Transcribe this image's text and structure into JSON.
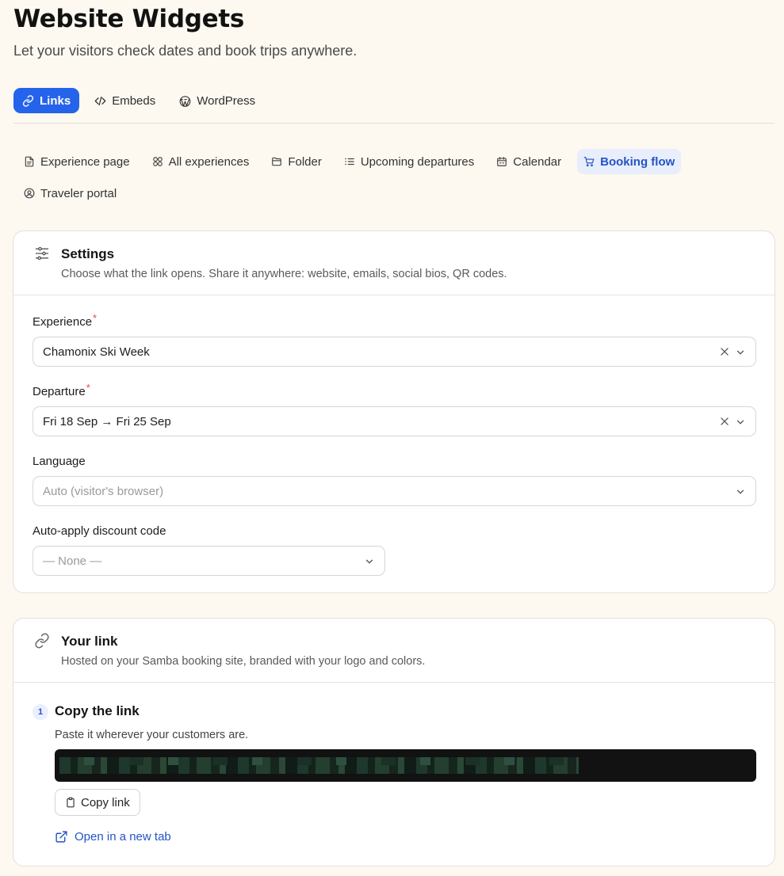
{
  "header": {
    "title": "Website Widgets",
    "subtitle": "Let your visitors check dates and book trips anywhere."
  },
  "tabs": [
    {
      "label": "Links",
      "icon": "link-icon",
      "active": true
    },
    {
      "label": "Embeds",
      "icon": "code-icon",
      "active": false
    },
    {
      "label": "WordPress",
      "icon": "wordpress-icon",
      "active": false
    }
  ],
  "subtabs": [
    {
      "label": "Experience page",
      "icon": "file-icon",
      "active": false
    },
    {
      "label": "All experiences",
      "icon": "grid-icon",
      "active": false
    },
    {
      "label": "Folder",
      "icon": "folder-icon",
      "active": false
    },
    {
      "label": "Upcoming departures",
      "icon": "list-icon",
      "active": false
    },
    {
      "label": "Calendar",
      "icon": "calendar-icon",
      "active": false
    },
    {
      "label": "Booking flow",
      "icon": "cart-icon",
      "active": true
    },
    {
      "label": "Traveler portal",
      "icon": "user-circle-icon",
      "active": false
    }
  ],
  "settings": {
    "title": "Settings",
    "description": "Choose what the link opens. Share it anywhere: website, emails, social bios, QR codes.",
    "experience": {
      "label": "Experience",
      "required_mark": "*",
      "value": "Chamonix Ski Week"
    },
    "departure": {
      "label": "Departure",
      "required_mark": "*",
      "value": "Fri 18 Sep → Fri 25 Sep"
    },
    "language": {
      "label": "Language",
      "placeholder": "Auto (visitor's browser)"
    },
    "discount": {
      "label": "Auto-apply discount code",
      "placeholder": "— None —"
    }
  },
  "your_link": {
    "title": "Your link",
    "description": "Hosted on your Samba booking site, branded with your logo and colors.",
    "step": {
      "number": "1",
      "title": "Copy the link",
      "description": "Paste it wherever your customers are."
    },
    "copy_label": "Copy link",
    "open_label": "Open in a new tab"
  },
  "colors": {
    "background": "#fdf9f1",
    "accent": "#2563eb",
    "active_subtab_bg": "#e8eefb",
    "required": "#e5484d"
  }
}
